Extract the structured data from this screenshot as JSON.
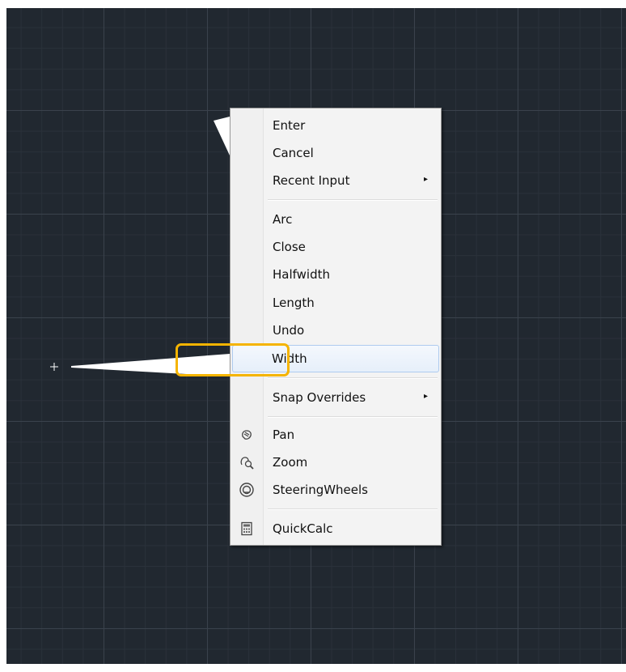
{
  "menu": {
    "items": [
      {
        "label": "Enter"
      },
      {
        "label": "Cancel"
      },
      {
        "label": "Recent Input",
        "submenu_arrow": "▸"
      },
      {
        "label": "Arc"
      },
      {
        "label": "Close"
      },
      {
        "label": "Halfwidth"
      },
      {
        "label": "Length"
      },
      {
        "label": "Undo"
      },
      {
        "label": "Width",
        "state": "hovered"
      },
      {
        "label": "Snap Overrides",
        "submenu_arrow": "▸"
      },
      {
        "label": "Pan",
        "icon": "pan-icon"
      },
      {
        "label": "Zoom",
        "icon": "zoom-icon"
      },
      {
        "label": "SteeringWheels",
        "icon": "steering-wheel-icon"
      },
      {
        "label": "QuickCalc",
        "icon": "calculator-icon"
      }
    ]
  },
  "colors": {
    "canvas_background": "#212830",
    "highlight_outline": "#f5b400",
    "menu_hover": "#e6effa"
  }
}
